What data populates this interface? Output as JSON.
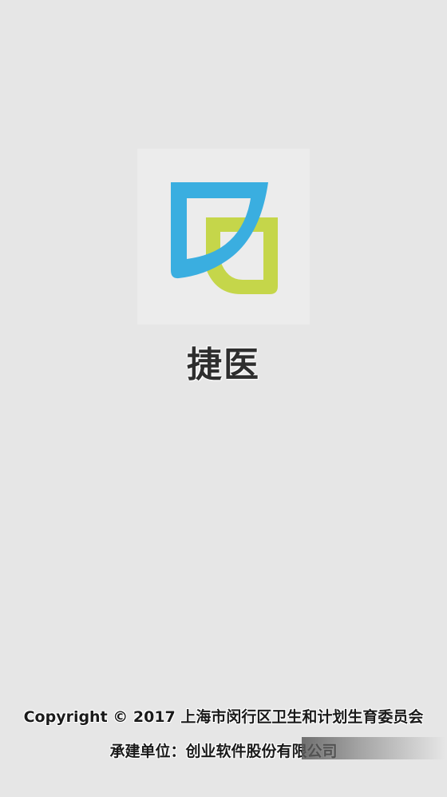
{
  "app": {
    "name": "捷医",
    "logo_icon": "jieyi-logo-icon",
    "colors": {
      "logo_blue": "#3aaee0",
      "logo_green": "#c5d64a",
      "background": "#e6e6e6"
    }
  },
  "footer": {
    "copyright": "Copyright © 2017 上海市闵行区卫生和计划生育委员会",
    "builder": "承建单位：创业软件股份有限公司"
  }
}
